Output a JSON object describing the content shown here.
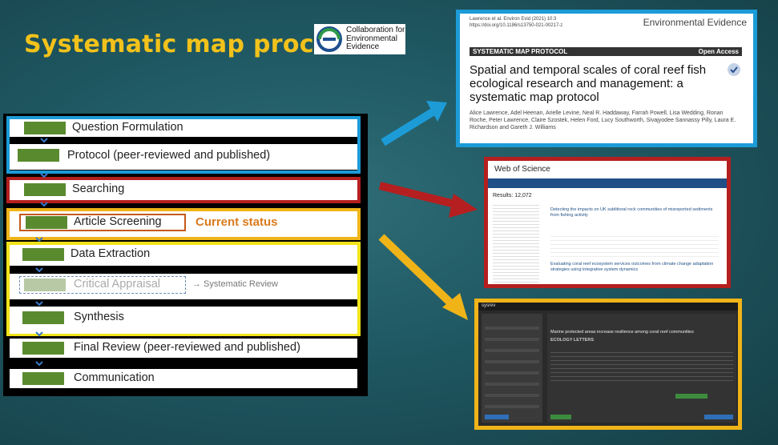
{
  "title": "Systematic map process",
  "logo": {
    "lines": [
      "Collaboration for",
      "Environmental",
      "Evidence"
    ]
  },
  "steps": [
    {
      "label": "Question Formulation"
    },
    {
      "label": "Protocol (peer-reviewed and published)"
    },
    {
      "label": "Searching"
    },
    {
      "label": "Article Screening"
    },
    {
      "label": "Data Extraction"
    },
    {
      "label": "Critical Appraisal"
    },
    {
      "label": "Synthesis"
    },
    {
      "label": "Final Review (peer-reviewed and published)"
    },
    {
      "label": "Communication"
    }
  ],
  "current_status": "Current status",
  "systematic_review_note": "→ Systematic Review",
  "colors": {
    "blue": "#1c9bd7",
    "red": "#b51f1f",
    "orange": "#f0b419",
    "yellow": "#f2e31a",
    "green": "#5a8a2e"
  },
  "publication": {
    "citation": "Lawrence et al. Environ Evid     (2021) 10:3",
    "doi": "https://doi.org/10.1186/s13750-021-00217-z",
    "journal": "Environmental Evidence",
    "banner": "SYSTEMATIC MAP PROTOCOL",
    "access": "Open Access",
    "heading": "Spatial and temporal scales of coral reef fish ecological research and management: a systematic map protocol",
    "authors": "Alice Lawrence, Adel Heenan, Arielle Levine, Neal R. Haddaway, Farrah Powell, Lisa Wedding, Ronan Roche, Peter Lawrence, Claire Szostek, Helen Ford, Lucy Southworth, Sivajyodee Sannassy Pilly, Laura E. Richardson and Gareth J. Williams"
  },
  "web_of_science": {
    "name": "Web of Science",
    "results": "Results: 12,072",
    "result1": "Detecting the impacts on UK sublittoral rock communities of misreported sediments from fishing activity",
    "result2": "Evaluating coral reef ecosystem services outcomes from climate change adaptation strategies using integrative system dynamics"
  },
  "sysrev": {
    "name": "sysrev",
    "article_title": "Marine protected areas increase resilience among coral reef communities",
    "journal": "ECOLOGY LETTERS"
  }
}
